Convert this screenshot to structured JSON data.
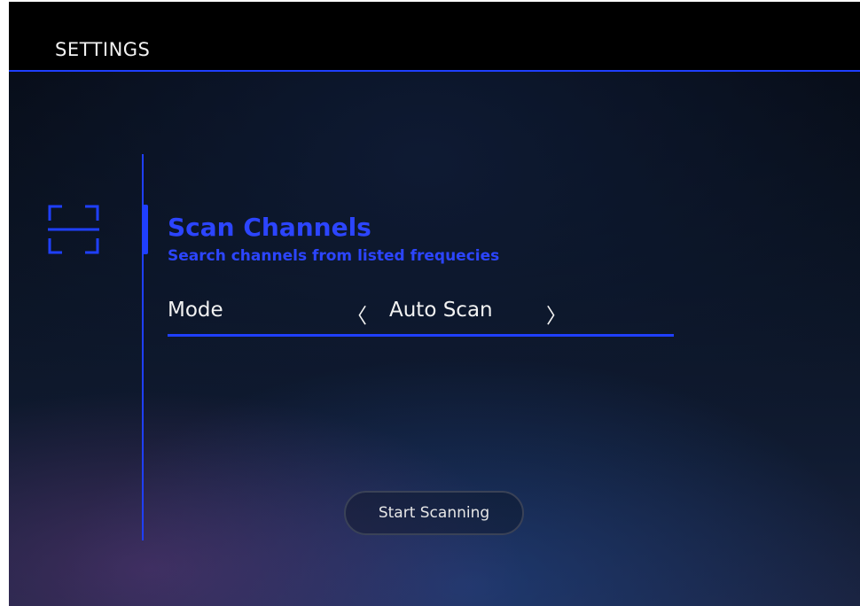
{
  "header": {
    "title": "SETTINGS"
  },
  "section": {
    "icon": "scan-frame-icon",
    "title": "Scan Channels",
    "subtitle": "Search channels from listed frequecies"
  },
  "mode": {
    "label": "Mode",
    "prev_icon": "chevron-left-icon",
    "prev_glyph": "〈",
    "value": "Auto Scan",
    "next_icon": "chevron-right-icon",
    "next_glyph": "〉"
  },
  "actions": {
    "start_label": "Start Scanning"
  },
  "colors": {
    "accent": "#1f3fff",
    "header_bg": "#000000",
    "text": "#f2f2f2"
  }
}
